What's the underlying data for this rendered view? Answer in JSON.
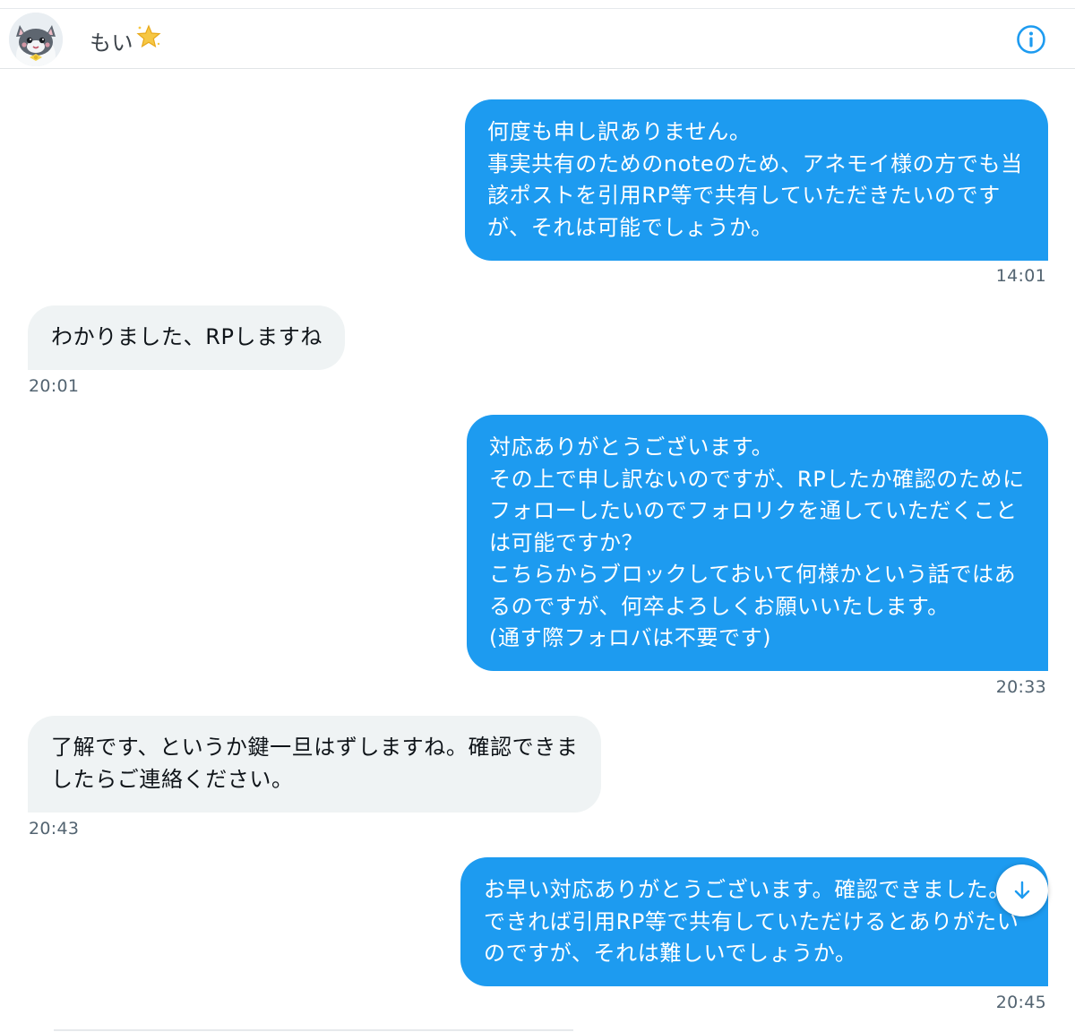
{
  "header": {
    "contact_name": "もい",
    "avatar_icon": "cat-avatar",
    "star_icon": "star-emoji-icon",
    "info_icon": "info-icon"
  },
  "messages": [
    {
      "direction": "out",
      "text": "何度も申し訳ありません。\n事実共有のためのnoteのため、アネモイ様の方でも当\n該ポストを引用RP等で共有していただきたいのです\nが、それは可能でしょうか。",
      "time": "14:01"
    },
    {
      "direction": "in",
      "text": "わかりました、RPしますね",
      "time": "20:01"
    },
    {
      "direction": "out",
      "text": "対応ありがとうございます。\nその上で申し訳ないのですが、RPしたか確認のために\nフォローしたいのでフォロリクを通していただくこと\nは可能ですか？\nこちらからブロックしておいて何様かという話ではあ\nるのですが、何卒よろしくお願いいたします。\n(通す際フォロバは不要です)",
      "time": "20:33"
    },
    {
      "direction": "in",
      "text": "了解です、というか鍵一旦はずしますね。確認できま\nしたらご連絡ください。",
      "time": "20:43"
    },
    {
      "direction": "out",
      "text": "お早い対応ありがとうございます。確認できました。\nできれば引用RP等で共有していただけるとありがたい\nのですが、それは難しいでしょうか。",
      "time": "20:45"
    }
  ],
  "scroll_button_icon": "arrow-down-icon",
  "colors": {
    "outgoing_bubble": "#1d9bf0",
    "incoming_bubble": "#eff3f4",
    "timestamp": "#536471",
    "info_icon": "#1d9bf0"
  }
}
